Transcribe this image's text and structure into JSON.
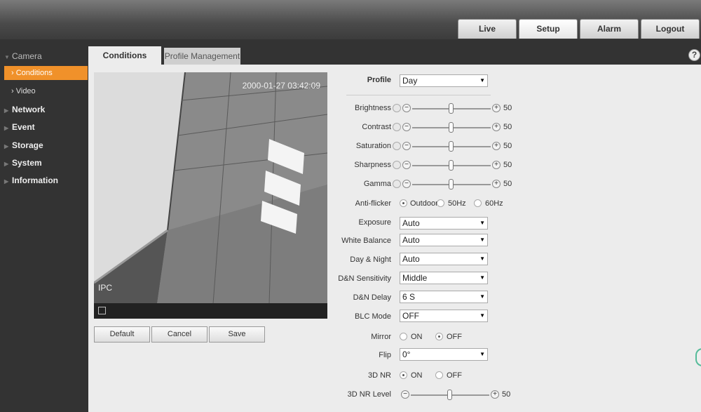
{
  "top_tabs": [
    "Live",
    "Setup",
    "Alarm",
    "Logout"
  ],
  "sidebar": {
    "camera": "Camera",
    "conditions": "Conditions",
    "video": "Video",
    "network": "Network",
    "event": "Event",
    "storage": "Storage",
    "system": "System",
    "information": "Information"
  },
  "page_tabs": {
    "conditions": "Conditions",
    "profile_management": "Profile Management"
  },
  "help": "?",
  "video": {
    "timestamp": "2000-01-27 03:42:09",
    "channel": "IPC"
  },
  "buttons": {
    "default": "Default",
    "cancel": "Cancel",
    "save": "Save"
  },
  "profile": {
    "label": "Profile",
    "value": "Day"
  },
  "sliders": [
    {
      "label": "Brightness",
      "value": "50",
      "level": 0.5
    },
    {
      "label": "Contrast",
      "value": "50",
      "level": 0.5
    },
    {
      "label": "Saturation",
      "value": "50",
      "level": 0.5
    },
    {
      "label": "Sharpness",
      "value": "50",
      "level": 0.5
    },
    {
      "label": "Gamma",
      "value": "50",
      "level": 0.5
    }
  ],
  "anti_flicker": {
    "label": "Anti-flicker",
    "options": [
      "Outdoor",
      "50Hz",
      "60Hz"
    ],
    "selected": "Outdoor"
  },
  "selects": {
    "exposure": {
      "label": "Exposure",
      "value": "Auto"
    },
    "white_balance": {
      "label": "White Balance",
      "value": "Auto"
    },
    "day_night": {
      "label": "Day & Night",
      "value": "Auto"
    },
    "dn_sensitivity": {
      "label": "D&N Sensitivity",
      "value": "Middle"
    },
    "dn_delay": {
      "label": "D&N Delay",
      "value": "6 S"
    },
    "blc_mode": {
      "label": "BLC Mode",
      "value": "OFF"
    },
    "flip": {
      "label": "Flip",
      "value": "0°"
    }
  },
  "mirror": {
    "label": "Mirror",
    "options": [
      "ON",
      "OFF"
    ],
    "selected": "OFF"
  },
  "nr3d": {
    "label": "3D NR",
    "options": [
      "ON",
      "OFF"
    ],
    "selected": "ON"
  },
  "nr3d_level": {
    "label": "3D NR Level",
    "value": "50",
    "level": 0.5
  },
  "colors": {
    "accent": "#f0912a",
    "topbar": "#4a4a4a",
    "sidebar": "#333333",
    "content": "#ececec"
  }
}
